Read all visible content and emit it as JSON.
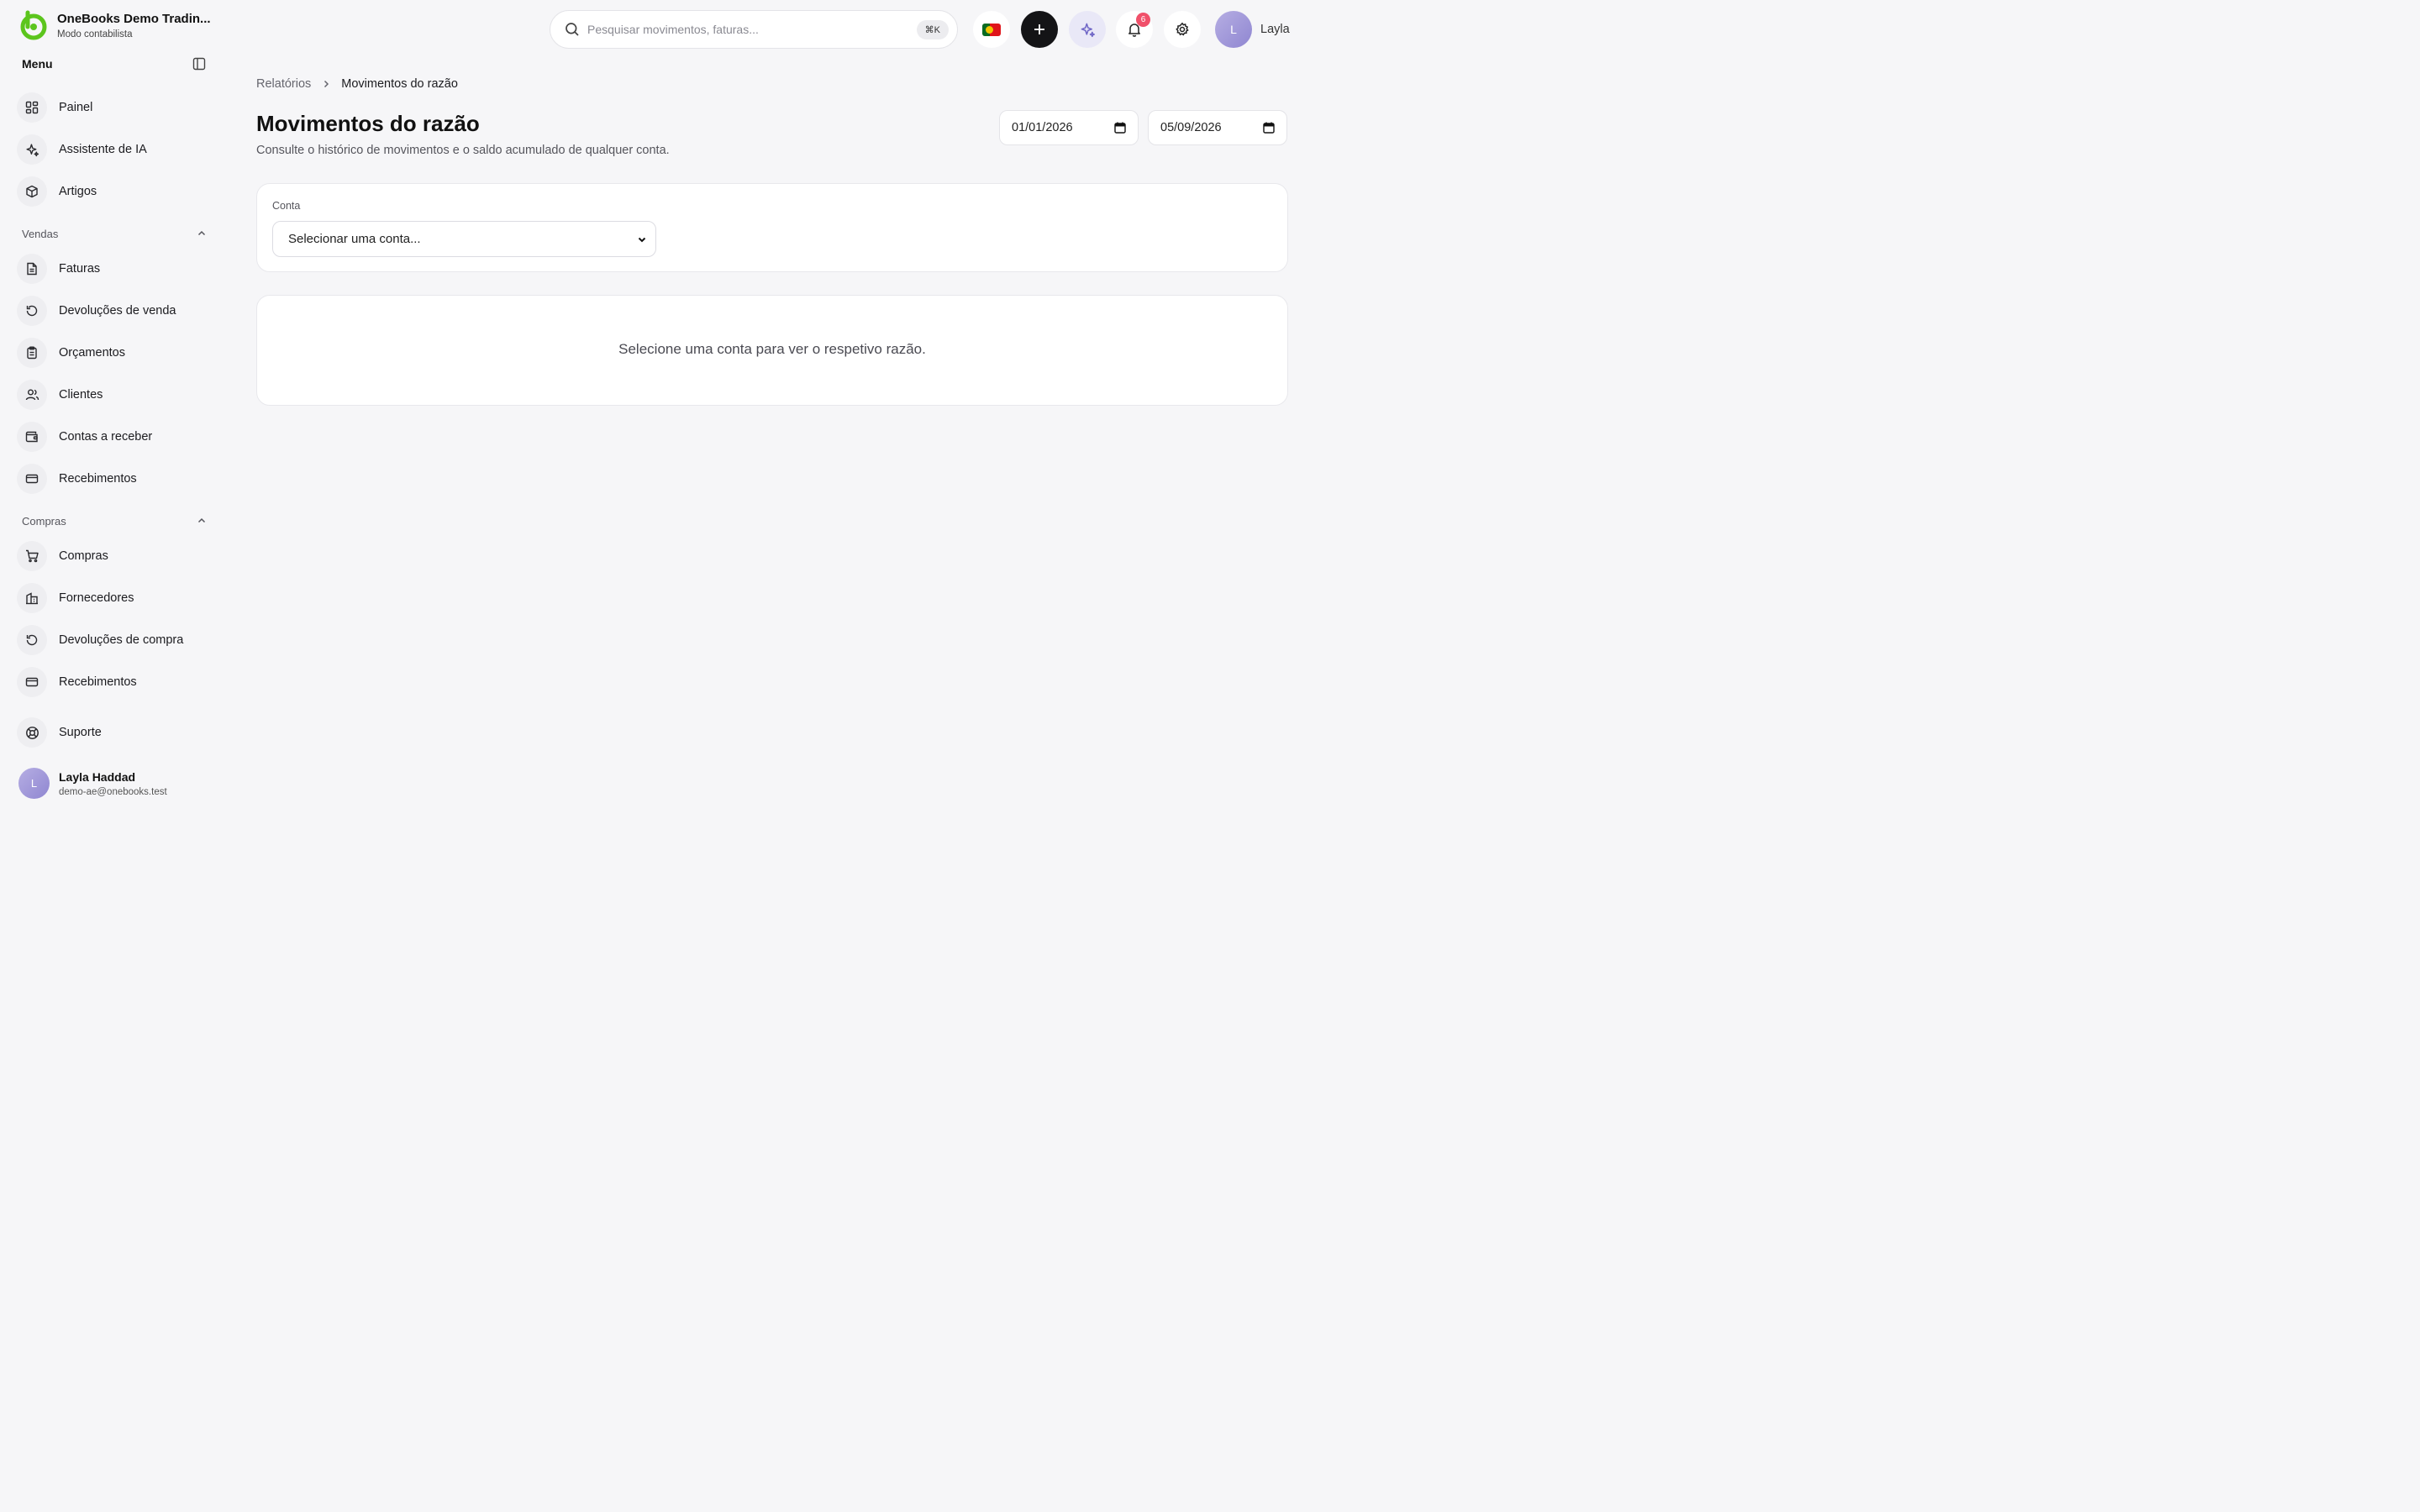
{
  "brand": {
    "name": "OneBooks Demo Tradin...",
    "mode": "Modo contabilista"
  },
  "sidebar": {
    "menu_title": "Menu",
    "top_items": [
      {
        "label": "Painel",
        "icon": "dashboard-icon"
      },
      {
        "label": "Assistente de IA",
        "icon": "sparkles-icon"
      },
      {
        "label": "Artigos",
        "icon": "package-icon"
      }
    ],
    "sections": [
      {
        "title": "Vendas",
        "items": [
          {
            "label": "Faturas",
            "icon": "file-text-icon"
          },
          {
            "label": "Devoluções de venda",
            "icon": "rotate-ccw-icon"
          },
          {
            "label": "Orçamentos",
            "icon": "clipboard-list-icon"
          },
          {
            "label": "Clientes",
            "icon": "users-icon"
          },
          {
            "label": "Contas a receber",
            "icon": "wallet-icon"
          },
          {
            "label": "Recebimentos",
            "icon": "credit-card-icon"
          }
        ]
      },
      {
        "title": "Compras",
        "items": [
          {
            "label": "Compras",
            "icon": "shopping-cart-icon"
          },
          {
            "label": "Fornecedores",
            "icon": "building-icon"
          },
          {
            "label": "Devoluções de compra",
            "icon": "rotate-ccw-icon"
          },
          {
            "label": "Recebimentos",
            "icon": "credit-card-icon"
          }
        ]
      }
    ],
    "support": {
      "label": "Suporte",
      "icon": "life-buoy-icon"
    },
    "user": {
      "initial": "L",
      "name": "Layla Haddad",
      "email": "demo-ae@onebooks.test"
    }
  },
  "topbar": {
    "search_placeholder": "Pesquisar movimentos, faturas...",
    "shortcut": "⌘K",
    "notifications_count": "6",
    "user_initial": "L",
    "user_name": "Layla",
    "flag": "portugal-flag-icon"
  },
  "main": {
    "breadcrumb_parent": "Relatórios",
    "breadcrumb_current": "Movimentos do razão",
    "title": "Movimentos do razão",
    "subtitle": "Consulte o histórico de movimentos e o saldo acumulado de qualquer conta.",
    "date_from": "01/01/2026",
    "date_to": "05/09/2026",
    "account_label": "Conta",
    "account_placeholder": "Selecionar uma conta...",
    "empty_message": "Selecione uma conta para ver o respetivo razão."
  },
  "colors": {
    "background": "#f6f6f8",
    "logo_green": "#5cc51d",
    "accent_lavender": "#6f66c6",
    "badge_red": "#f0506a"
  }
}
